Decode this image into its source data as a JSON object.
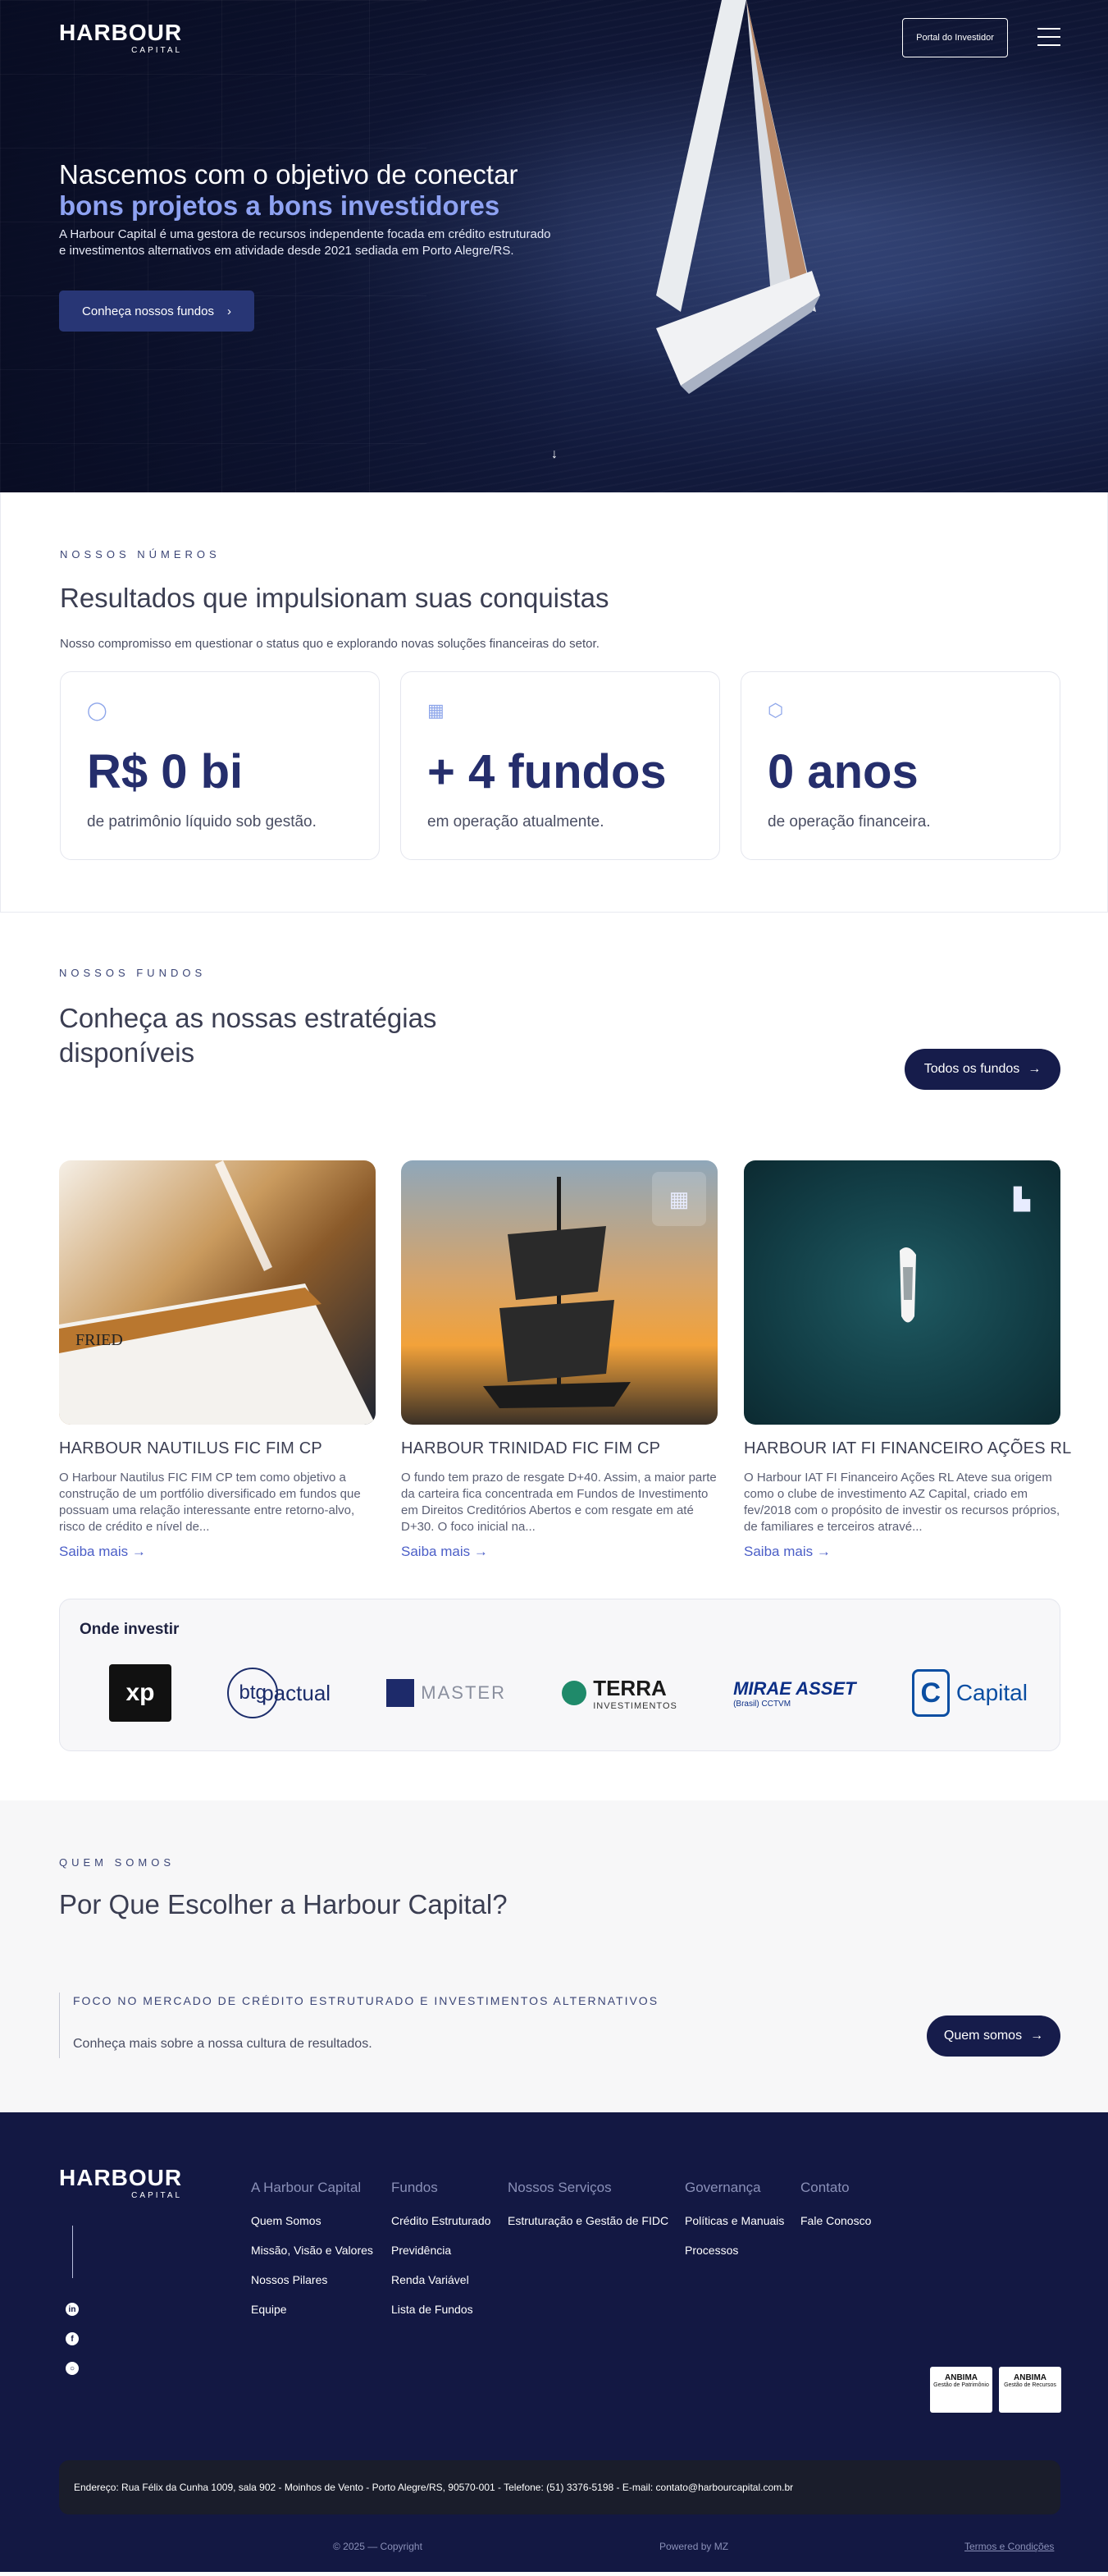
{
  "brand": {
    "name": "HARBOUR",
    "sub": "CAPITAL"
  },
  "header": {
    "portal_label": "Portal do Investidor",
    "menu_icon": "hamburger-menu-icon"
  },
  "hero": {
    "title_line1": "Nascemos com o objetivo de conectar",
    "title_line2": "bons projetos a bons investidores",
    "lead": "A Harbour Capital é uma gestora de recursos independente focada em crédito estruturado e investimentos alternativos em atividade desde 2021 sediada em Porto Alegre/RS.",
    "cta_label": "Conheça nossos fundos"
  },
  "numbers": {
    "eyebrow": "NOSSOS NÚMEROS",
    "title": "Resultados que impulsionam suas conquistas",
    "subtitle": "Nosso compromisso em questionar o status quo e explorando novas soluções financeiras do setor.",
    "stats": [
      {
        "icon": "coins-icon",
        "value": "R$ 0 bi",
        "caption": "de patrimônio líquido sob gestão."
      },
      {
        "icon": "grid-icon",
        "value": "+ 4 fundos",
        "caption": "em operação atualmente."
      },
      {
        "icon": "cube-icon",
        "value": "0 anos",
        "caption": "de operação financeira."
      }
    ]
  },
  "funds": {
    "eyebrow": "NOSSOS FUNDOS",
    "title": "Conheça as nossas estratégias disponíveis",
    "all_label": "Todos os fundos",
    "more_label": "Saiba mais",
    "cards": [
      {
        "name": "HARBOUR NAUTILUS FIC FIM CP",
        "desc": "O Harbour Nautilus FIC FIM CP tem como objetivo a construção de um portfólio diversificado em fundos que possuam uma relação interessante entre retorno-alvo, risco de crédito e nível de..."
      },
      {
        "name": "HARBOUR TRINIDAD FIC FIM CP",
        "desc": "O fundo tem prazo de resgate D+40. Assim, a maior parte da carteira fica concentrada em Fundos de Investimento em Direitos Creditórios Abertos e com resgate em até D+30. O foco inicial na..."
      },
      {
        "name": "HARBOUR IAT FI FINANCEIRO AÇÕES RL",
        "desc": "O Harbour IAT FI Financeiro Ações RL Ateve sua origem como o clube de investimento AZ Capital, criado em fev/2018 com o propósito de investir os recursos próprios, de familiares e terceiros atravé..."
      }
    ]
  },
  "where": {
    "title": "Onde investir",
    "platforms": [
      "xp",
      "btg",
      "pactual",
      "MASTER",
      "TERRA",
      "INVESTIMENTOS",
      "MIRAE ASSET",
      "(Brasil) CCTVM",
      "Capital"
    ]
  },
  "why": {
    "eyebrow": "QUEM SOMOS",
    "title": "Por Que Escolher a Harbour Capital?",
    "focus_label": "FOCO NO MERCADO DE CRÉDITO ESTRUTURADO E INVESTIMENTOS ALTERNATIVOS",
    "focus_desc": "Conheça mais sobre a nossa cultura de resultados.",
    "cta_label": "Quem somos"
  },
  "footer": {
    "columns": [
      {
        "title": "A Harbour Capital",
        "items": [
          "Quem Somos",
          "Missão, Visão e Valores",
          "Nossos Pilares",
          "Equipe"
        ]
      },
      {
        "title": "Fundos",
        "items": [
          "Crédito Estruturado",
          "Previdência",
          "Renda Variável",
          "Lista de Fundos"
        ]
      },
      {
        "title": "Nossos Serviços",
        "items": [
          "Estruturação e Gestão de FIDC"
        ]
      },
      {
        "title": "Governança",
        "items": [
          "Políticas e Manuais",
          "Processos"
        ]
      },
      {
        "title": "Contato",
        "items": [
          "Fale Conosco"
        ]
      }
    ],
    "badges": [
      {
        "name": "ANBIMA",
        "caption": "Gestão de Patrimônio"
      },
      {
        "name": "ANBIMA",
        "caption": "Gestão de Recursos"
      }
    ],
    "address": "Endereço: Rua Félix da Cunha 1009, sala 902 - Moinhos de Vento - Porto Alegre/RS, 90570-001 - Telefone: (51) 3376-5198 - E-mail: contato@harbourcapital.com.br",
    "copyright": "© 2025 — Copyright",
    "powered": "Powered by MZ",
    "terms": "Termos e Condições"
  }
}
